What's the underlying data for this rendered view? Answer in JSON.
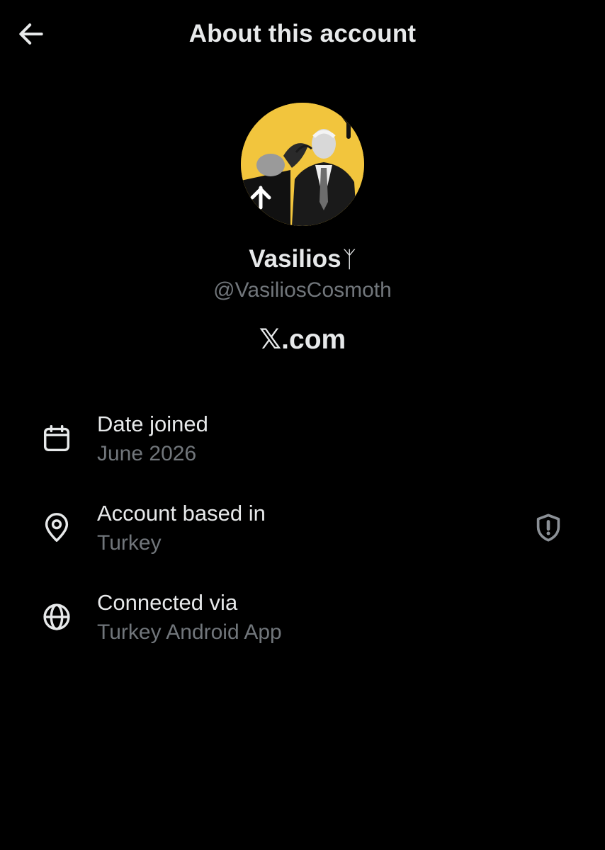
{
  "header": {
    "title": "About this account",
    "back_icon": "arrow-left-icon"
  },
  "profile": {
    "name": "Vasilios",
    "name_glyph": "ᛉ",
    "handle": "@VasiliosCosmoth",
    "brand": "𝕏.com",
    "avatar_bg": "#f2c53d"
  },
  "details": [
    {
      "icon": "calendar-icon",
      "label": "Date joined",
      "value": "June 2026"
    },
    {
      "icon": "location-pin-icon",
      "label": "Account based in",
      "value": "Turkey",
      "action_icon": "shield-alert-icon"
    },
    {
      "icon": "globe-icon",
      "label": "Connected via",
      "value": "Turkey Android App"
    }
  ],
  "colors": {
    "background": "#000000",
    "primary_text": "#e7e9ea",
    "secondary_text": "#71767b"
  }
}
